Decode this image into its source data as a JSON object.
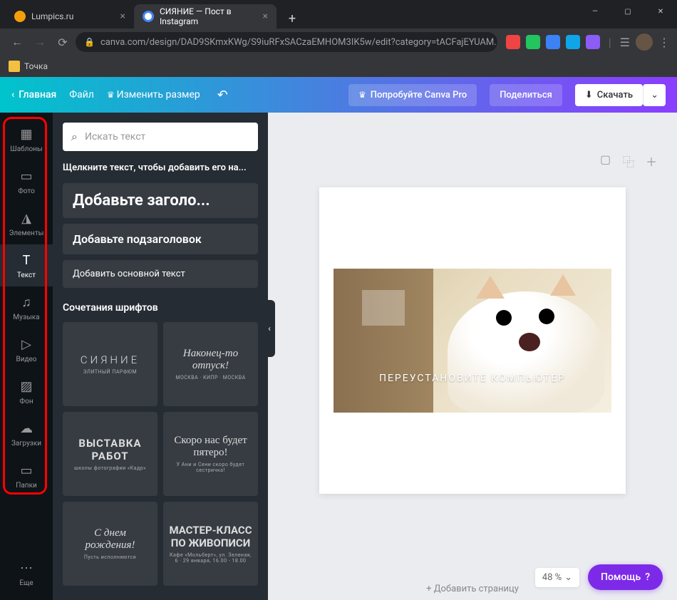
{
  "window": {
    "minimize": "—",
    "maximize": "▢",
    "close": "✕"
  },
  "tabs": [
    {
      "title": "Lumpics.ru",
      "active": false,
      "favicon_color": "#f59e0b"
    },
    {
      "title": "СИЯНИЕ — Пост в Instagram",
      "active": true,
      "favicon_color": "#4285f4"
    }
  ],
  "address": {
    "url": "canva.com/design/DAD9SKmxKWg/S9iuRFxSACzaEMHOM3IK5w/edit?category=tACFajEYUAM..."
  },
  "bookmarks": [
    {
      "label": "Точка"
    }
  ],
  "canva_header": {
    "back": "Главная",
    "file": "Файл",
    "resize": "Изменить размер",
    "try_pro": "Попробуйте Canva Pro",
    "share": "Поделиться",
    "download": "Скачать"
  },
  "sidebar": [
    {
      "key": "templates",
      "label": "Шаблоны",
      "icon": "▦"
    },
    {
      "key": "photo",
      "label": "Фото",
      "icon": "▭"
    },
    {
      "key": "elements",
      "label": "Элементы",
      "icon": "◮"
    },
    {
      "key": "text",
      "label": "Текст",
      "icon": "T",
      "active": true
    },
    {
      "key": "music",
      "label": "Музыка",
      "icon": "♫"
    },
    {
      "key": "video",
      "label": "Видео",
      "icon": "▷"
    },
    {
      "key": "background",
      "label": "Фон",
      "icon": "▨"
    },
    {
      "key": "uploads",
      "label": "Загрузки",
      "icon": "☁"
    },
    {
      "key": "folders",
      "label": "Папки",
      "icon": "▭"
    },
    {
      "key": "more",
      "label": "Еще",
      "icon": "⋯"
    }
  ],
  "panel": {
    "search_placeholder": "Искать текст",
    "hint": "Щелкните текст, чтобы добавить его на...",
    "add_heading": "Добавьте заголо...",
    "add_subheading": "Добавьте подзаголовок",
    "add_body": "Добавить основной текст",
    "combos_label": "Сочетания шрифтов",
    "combos": [
      {
        "main": "СИЯНИЕ",
        "sub": "ЭЛИТНЫЙ ПАРФЮМ",
        "style": "letter-spacing:4px;font-weight:300;"
      },
      {
        "main": "Наконец-то отпуск!",
        "sub": "МОСКВА · КИПР · МОСКВА",
        "style": "font-style:italic;font-family:cursive;"
      },
      {
        "main": "ВЫСТАВКА РАБОТ",
        "sub": "школы фотографии «Кадр»",
        "style": "font-weight:700;letter-spacing:1px;"
      },
      {
        "main": "Скоро нас будет пятеро!",
        "sub": "У Ани и Сени скоро будет сестричка!",
        "style": "font-family:cursive;"
      },
      {
        "main": "С днем рождения!",
        "sub": "Пусть исполняются",
        "style": "font-style:italic;font-family:cursive;"
      },
      {
        "main": "МАСТЕР-КЛАСС ПО ЖИВОПИСИ",
        "sub": "Кафе «Мольберт», ул. Зеленая, 6 · 29 января, 16.00 - 18.00",
        "style": "font-weight:700;"
      }
    ]
  },
  "canvas": {
    "image_text": "ПЕРЕУСТАНОВИТЕ КОМПЬЮТЕР",
    "add_page": "+ Добавить страницу",
    "zoom": "48 %",
    "help": "Помощь"
  },
  "extension_colors": [
    "#ef4444",
    "#22c55e",
    "#3b82f6",
    "#0ea5e9",
    "#8b5cf6"
  ]
}
